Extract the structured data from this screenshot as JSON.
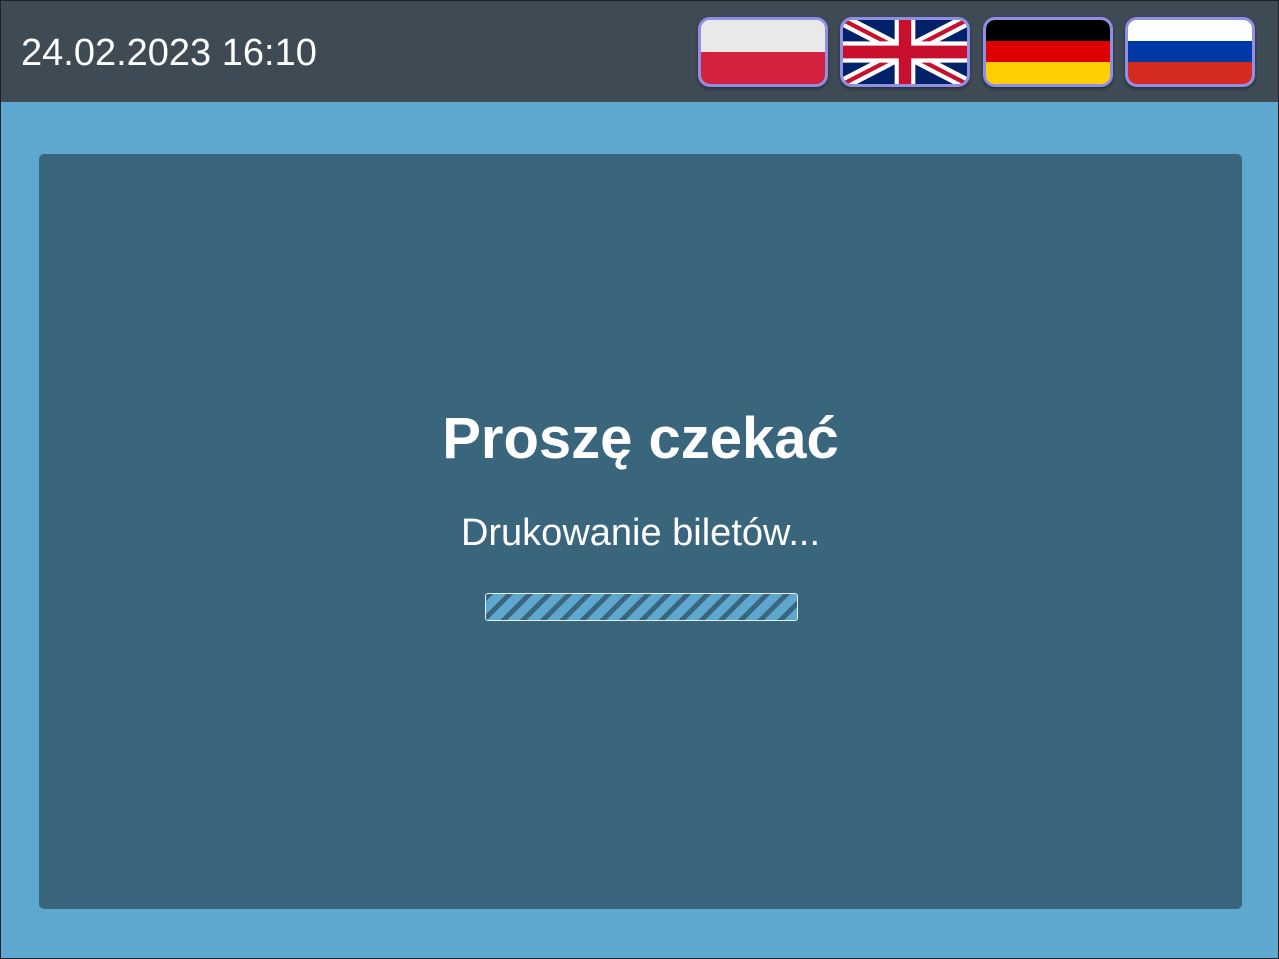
{
  "header": {
    "datetime": "24.02.2023 16:10",
    "languages": [
      {
        "code": "pl",
        "icon": "poland-flag-icon",
        "colors": [
          "#e9e9e9",
          "#d4213d"
        ]
      },
      {
        "code": "en",
        "icon": "uk-flag-icon",
        "colors": [
          "#012169",
          "#ffffff",
          "#c8102e"
        ]
      },
      {
        "code": "de",
        "icon": "germany-flag-icon",
        "colors": [
          "#000000",
          "#dd0000",
          "#ffce00"
        ]
      },
      {
        "code": "ru",
        "icon": "russia-flag-icon",
        "colors": [
          "#ffffff",
          "#0039a6",
          "#d52b1e"
        ]
      }
    ]
  },
  "main": {
    "title": "Proszę czekać",
    "message": "Drukowanie biletów...",
    "progress": {
      "state": "indeterminate"
    }
  },
  "colors": {
    "topbar": "#3e4a54",
    "background": "#5ea8d0",
    "panel": "#3a667d",
    "flag_border": "#8f8fe8",
    "text": "#ffffff"
  }
}
